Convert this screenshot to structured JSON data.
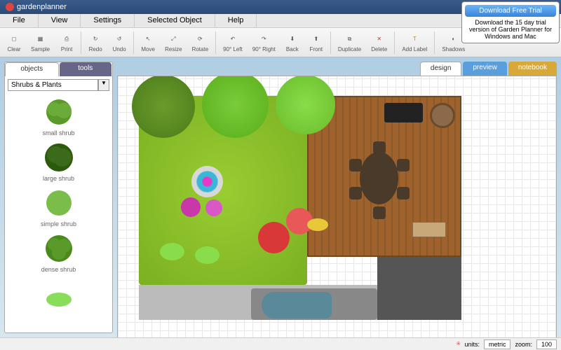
{
  "app": {
    "title": "gardenplanner"
  },
  "menu": {
    "file": "File",
    "view": "View",
    "settings": "Settings",
    "selected": "Selected Object",
    "help": "Help"
  },
  "toolbar": {
    "clear": "Clear",
    "sample": "Sample",
    "print": "Print",
    "redo": "Redo",
    "undo": "Undo",
    "move": "Move",
    "resize": "Resize",
    "rotate": "Rotate",
    "left90": "90° Left",
    "right90": "90° Right",
    "back": "Back",
    "front": "Front",
    "duplicate": "Duplicate",
    "delete": "Delete",
    "addlabel": "Add Label",
    "shadows": "Shadows"
  },
  "sidebar": {
    "tabs": {
      "objects": "objects",
      "tools": "tools"
    },
    "category": "Shrubs & Plants",
    "items": [
      {
        "label": "small shrub"
      },
      {
        "label": "large shrub"
      },
      {
        "label": "simple shrub"
      },
      {
        "label": "dense shrub"
      }
    ]
  },
  "viewtabs": {
    "design": "design",
    "preview": "preview",
    "notebook": "notebook"
  },
  "status": {
    "units_label": "units:",
    "units_value": "metric",
    "zoom_label": "zoom:",
    "zoom_value": "100"
  },
  "trial": {
    "button": "Download Free Trial",
    "text": "Download the 15 day trial version of Garden Planner for Windows and Mac"
  }
}
